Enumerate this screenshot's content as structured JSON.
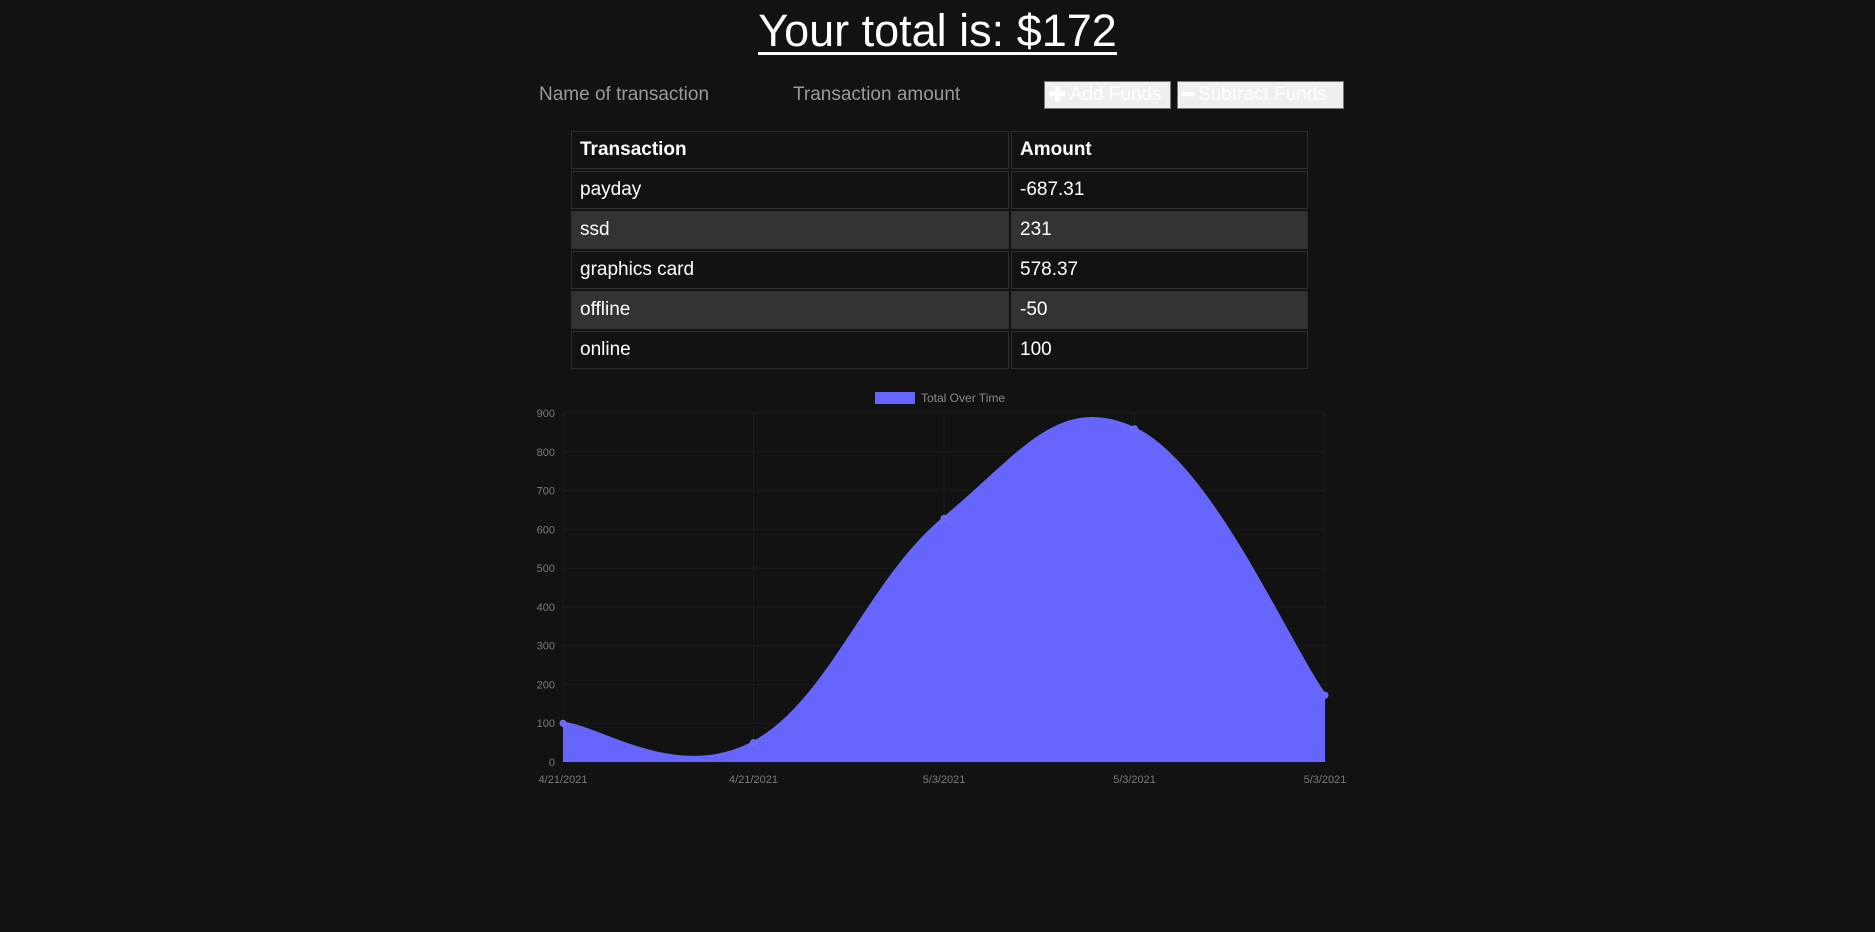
{
  "header": {
    "title_prefix": "Your total is: ",
    "total": "$172"
  },
  "form": {
    "name_placeholder": "Name of transaction",
    "amount_placeholder": "Transaction amount",
    "add_label": "Add Funds",
    "add_icon": "plus-icon",
    "subtract_label": "Subtract Funds",
    "subtract_icon": "minus-icon"
  },
  "table": {
    "headers": [
      "Transaction",
      "Amount"
    ],
    "rows": [
      {
        "name": "payday",
        "amount": "-687.31"
      },
      {
        "name": "ssd",
        "amount": "231"
      },
      {
        "name": "graphics card",
        "amount": "578.37"
      },
      {
        "name": "offline",
        "amount": "-50"
      },
      {
        "name": "online",
        "amount": "100"
      }
    ]
  },
  "colors": {
    "background": "#121212",
    "fill": "#6666ff",
    "alt_row": "#333333"
  },
  "chart_data": {
    "type": "area",
    "categories": [
      "4/21/2021",
      "4/21/2021",
      "5/3/2021",
      "5/3/2021",
      "5/3/2021"
    ],
    "series": [
      {
        "name": "Total Over Time",
        "values": [
          100,
          50,
          628.37,
          859.37,
          172.06
        ]
      }
    ],
    "yticks": [
      0,
      100,
      200,
      300,
      400,
      500,
      600,
      700,
      800,
      900
    ],
    "ylim": [
      0,
      900
    ],
    "grid": true,
    "legend": "top-center",
    "smooth": true
  }
}
